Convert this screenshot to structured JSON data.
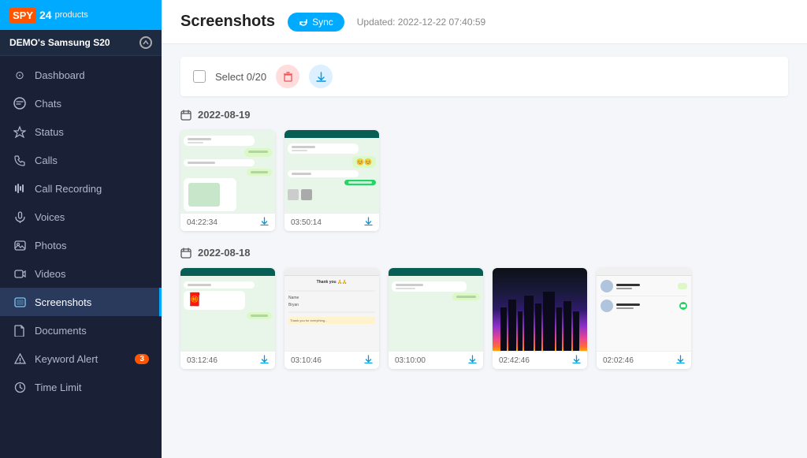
{
  "app": {
    "logo_spy": "SPY",
    "logo_24": "24",
    "logo_products": "products"
  },
  "sidebar": {
    "device": "DEMO's Samsung S20",
    "items": [
      {
        "id": "dashboard",
        "label": "Dashboard",
        "icon": "⊙",
        "active": false
      },
      {
        "id": "chats",
        "label": "Chats",
        "icon": "💬",
        "active": false
      },
      {
        "id": "status",
        "label": "Status",
        "icon": "⚡",
        "active": false
      },
      {
        "id": "calls",
        "label": "Calls",
        "icon": "📞",
        "active": false
      },
      {
        "id": "call-recording",
        "label": "Call Recording",
        "icon": "📊",
        "active": false
      },
      {
        "id": "voices",
        "label": "Voices",
        "icon": "🎙",
        "active": false
      },
      {
        "id": "photos",
        "label": "Photos",
        "icon": "🖼",
        "active": false
      },
      {
        "id": "videos",
        "label": "Videos",
        "icon": "📹",
        "active": false
      },
      {
        "id": "screenshots",
        "label": "Screenshots",
        "icon": "🖥",
        "active": true
      },
      {
        "id": "documents",
        "label": "Documents",
        "icon": "📄",
        "active": false
      },
      {
        "id": "keyword-alert",
        "label": "Keyword Alert",
        "icon": "⚠",
        "active": false,
        "badge": "3"
      },
      {
        "id": "time-limit",
        "label": "Time Limit",
        "icon": "⏱",
        "active": false
      }
    ]
  },
  "header": {
    "title": "Screenshots",
    "sync_label": "Sync",
    "updated_text": "Updated: 2022-12-22 07:40:59"
  },
  "toolbar": {
    "select_label": "Select  0/20"
  },
  "sections": [
    {
      "date": "2022-08-19",
      "screenshots": [
        {
          "id": "s1",
          "time": "04:22:34",
          "type": "chat-wa"
        },
        {
          "id": "s2",
          "time": "03:50:14",
          "type": "chat-emoji"
        }
      ]
    },
    {
      "date": "2022-08-18",
      "screenshots": [
        {
          "id": "s3",
          "time": "03:12:46",
          "type": "chat-sticker"
        },
        {
          "id": "s4",
          "time": "03:10:46",
          "type": "chat-msg"
        },
        {
          "id": "s5",
          "time": "03:10:00",
          "type": "chat-wa2"
        },
        {
          "id": "s6",
          "time": "02:42:46",
          "type": "city"
        },
        {
          "id": "s7",
          "time": "02:02:46",
          "type": "contacts"
        }
      ]
    }
  ]
}
